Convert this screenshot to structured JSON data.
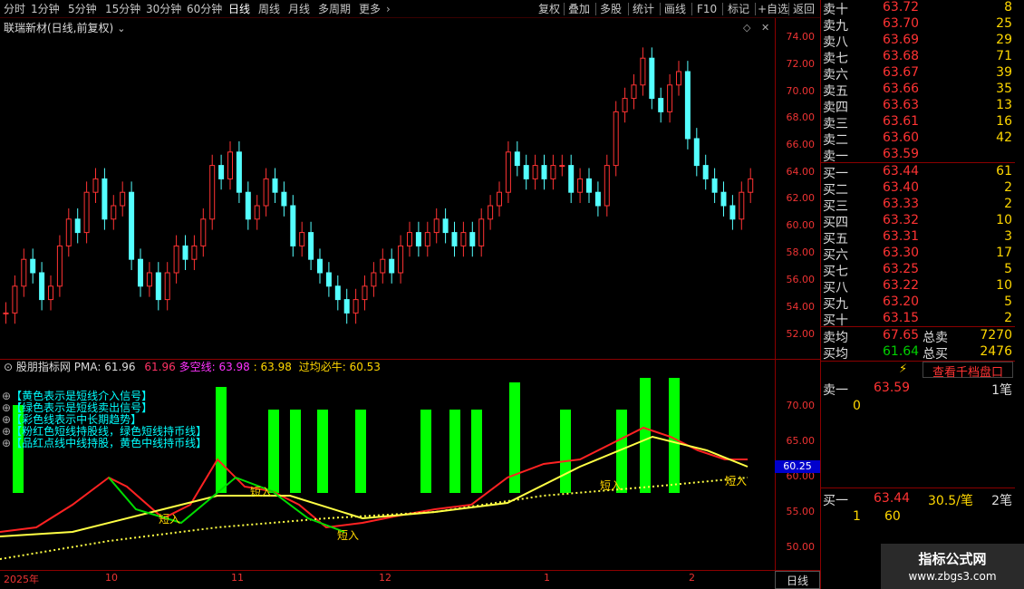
{
  "toolbar": {
    "periods": [
      "分时",
      "1分钟",
      "5分钟",
      "15分钟",
      "30分钟",
      "60分钟",
      "日线",
      "周线",
      "月线",
      "多周期",
      "更多"
    ],
    "active_period": "日线",
    "buttons": [
      "复权",
      "叠加",
      "多股",
      "统计",
      "画线",
      "F10",
      "标记",
      "+自选",
      "返回"
    ]
  },
  "main_chart": {
    "title": "联瑞新材(日线,前复权)",
    "price_axis": [
      "74.00",
      "72.00",
      "70.00",
      "68.00",
      "66.00",
      "64.00",
      "62.00",
      "60.00",
      "58.00",
      "56.00",
      "54.00",
      "52.00"
    ]
  },
  "sub_chart": {
    "name": "股朋指标网",
    "pma_label": "PMA:",
    "pma_value": "61.96",
    "v2": "61.96",
    "dk_label": "多空线:",
    "dk_value": "63.98",
    "v3": ": 63.98",
    "gj_label": "过均必牛:",
    "gj_value": "60.53",
    "legend": [
      "【黄色表示是短线介入信号】",
      "【绿色表示是短线卖出信号】",
      "【彩色线表示中长期趋势】",
      "【粉红色短线持股线，绿色短线持币线】",
      "【品红点线中线持股，黄色中线持币线】"
    ],
    "axis": [
      "70.00",
      "65.00",
      "60.00",
      "55.00",
      "50.00"
    ],
    "current_price": "60.25",
    "short_labels": [
      "短入",
      "短入",
      "短入",
      "短入",
      "短入"
    ]
  },
  "dates": [
    "2025年",
    "10",
    "11",
    "12",
    "1",
    "2"
  ],
  "order_book": {
    "asks": [
      {
        "label": "卖十",
        "price": "63.72",
        "vol": "8"
      },
      {
        "label": "卖九",
        "price": "63.70",
        "vol": "25"
      },
      {
        "label": "卖八",
        "price": "63.69",
        "vol": "29"
      },
      {
        "label": "卖七",
        "price": "63.68",
        "vol": "71"
      },
      {
        "label": "卖六",
        "price": "63.67",
        "vol": "39"
      },
      {
        "label": "卖五",
        "price": "63.66",
        "vol": "35"
      },
      {
        "label": "卖四",
        "price": "63.63",
        "vol": "13"
      },
      {
        "label": "卖三",
        "price": "63.61",
        "vol": "16"
      },
      {
        "label": "卖二",
        "price": "63.60",
        "vol": "42"
      },
      {
        "label": "卖一",
        "price": "63.59",
        "vol": ""
      }
    ],
    "bids": [
      {
        "label": "买一",
        "price": "63.44",
        "vol": "61"
      },
      {
        "label": "买二",
        "price": "63.40",
        "vol": "2"
      },
      {
        "label": "买三",
        "price": "63.33",
        "vol": "2"
      },
      {
        "label": "买四",
        "price": "63.32",
        "vol": "10"
      },
      {
        "label": "买五",
        "price": "63.31",
        "vol": "3"
      },
      {
        "label": "买六",
        "price": "63.30",
        "vol": "17"
      },
      {
        "label": "买七",
        "price": "63.25",
        "vol": "5"
      },
      {
        "label": "买八",
        "price": "63.22",
        "vol": "10"
      },
      {
        "label": "买九",
        "price": "63.20",
        "vol": "5"
      },
      {
        "label": "买十",
        "price": "63.15",
        "vol": "2"
      }
    ],
    "avg_sell_label": "卖均",
    "avg_sell": "67.65",
    "total_sell_label": "总卖",
    "total_sell": "7270",
    "avg_buy_label": "买均",
    "avg_buy": "61.64",
    "total_buy_label": "总买",
    "total_buy": "2476",
    "view_depth": "查看千档盘口",
    "sell1_label": "卖一",
    "sell1_price": "63.59",
    "sell1_count": "1笔",
    "sell1_qty": "0",
    "buy1_label": "买一",
    "buy1_price": "63.44",
    "buy1_avg": "30.5/笔",
    "buy1_count": "2笔",
    "buy1_q1": "1",
    "buy1_q2": "60"
  },
  "bottom_tab": "日线",
  "watermark": {
    "line1": "指标公式网",
    "line2": "www.zbgs3.com"
  }
}
